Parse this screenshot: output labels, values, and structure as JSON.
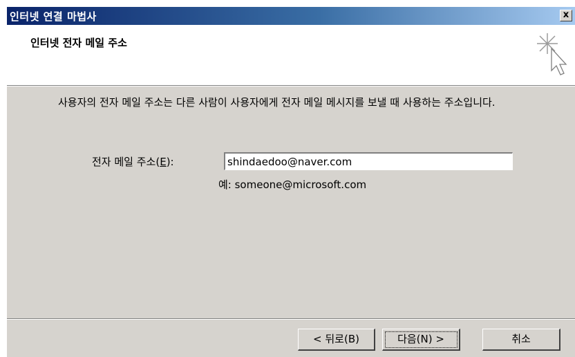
{
  "window": {
    "title": "인터넷 연결 마법사",
    "close_label": "x"
  },
  "header": {
    "title": "인터넷 전자 메일 주소"
  },
  "main": {
    "description": "사용자의 전자 메일 주소는 다른 사람이 사용자에게 전자 메일 메시지를 보낼 때 사용하는 주소입니다.",
    "email_label_prefix": "전자 메일 주소(",
    "email_label_key": "E",
    "email_label_suffix": "):",
    "email_value": "shindaedoo@naver.com",
    "example": "예: someone@microsoft.com"
  },
  "buttons": {
    "back": "< 뒤로(B)",
    "next": "다음(N) >",
    "cancel": "취소"
  },
  "colors": {
    "title_bar_start": "#0a246a",
    "title_bar_end": "#a6caf0",
    "dialog_face": "#d6d3ce"
  },
  "icons": {
    "wizard": "wizard-sparkle-cursor-icon",
    "close": "close-icon"
  }
}
